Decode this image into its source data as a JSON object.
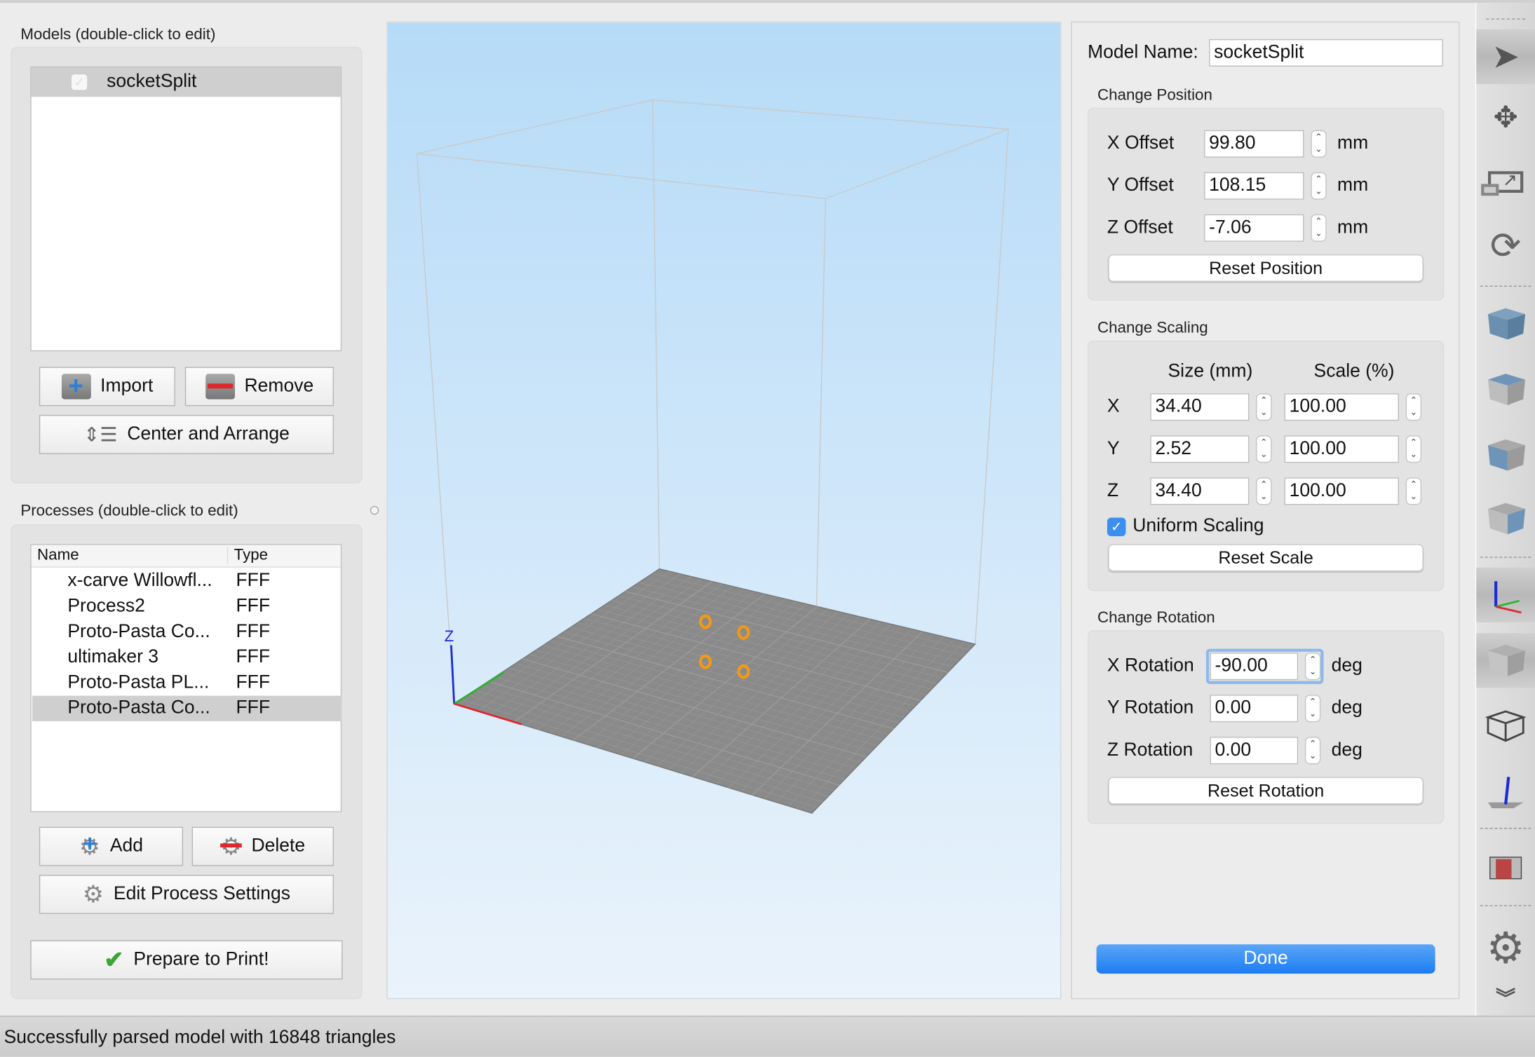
{
  "models": {
    "label": "Models (double-click to edit)",
    "items": [
      {
        "name": "socketSplit",
        "checked": true,
        "selected": true
      }
    ],
    "import_label": "Import",
    "remove_label": "Remove",
    "center_label": "Center and Arrange"
  },
  "processes": {
    "label": "Processes (double-click to edit)",
    "columns": [
      "Name",
      "Type"
    ],
    "rows": [
      {
        "name": "x-carve Willowfl...",
        "type": "FFF"
      },
      {
        "name": "Process2",
        "type": "FFF"
      },
      {
        "name": "Proto-Pasta Co...",
        "type": "FFF"
      },
      {
        "name": "ultimaker 3",
        "type": "FFF"
      },
      {
        "name": "Proto-Pasta PL...",
        "type": "FFF"
      },
      {
        "name": "Proto-Pasta Co...",
        "type": "FFF",
        "selected": true
      }
    ],
    "add_label": "Add",
    "delete_label": "Delete",
    "edit_label": "Edit Process Settings",
    "prepare_label": "Prepare to Print!"
  },
  "viewport": {
    "axis_z_label": "Z",
    "bg_top": "#b6dbf8",
    "bg_bottom": "#eaf3fb",
    "plate_color": "#8a8a8a",
    "model_color": "#f39a12"
  },
  "editor": {
    "model_name_label": "Model Name:",
    "model_name": "socketSplit",
    "position": {
      "title": "Change Position",
      "rows": [
        {
          "label": "X Offset",
          "value": "99.80",
          "unit": "mm"
        },
        {
          "label": "Y Offset",
          "value": "108.15",
          "unit": "mm"
        },
        {
          "label": "Z Offset",
          "value": "-7.06",
          "unit": "mm"
        }
      ],
      "reset_label": "Reset Position"
    },
    "scaling": {
      "title": "Change Scaling",
      "size_header": "Size (mm)",
      "scale_header": "Scale (%)",
      "rows": [
        {
          "axis": "X",
          "size": "34.40",
          "scale": "100.00"
        },
        {
          "axis": "Y",
          "size": "2.52",
          "scale": "100.00"
        },
        {
          "axis": "Z",
          "size": "34.40",
          "scale": "100.00"
        }
      ],
      "uniform_label": "Uniform Scaling",
      "uniform_checked": true,
      "reset_label": "Reset Scale"
    },
    "rotation": {
      "title": "Change Rotation",
      "rows": [
        {
          "label": "X Rotation",
          "value": "-90.00",
          "unit": "deg"
        },
        {
          "label": "Y Rotation",
          "value": "0.00",
          "unit": "deg"
        },
        {
          "label": "Z Rotation",
          "value": "0.00",
          "unit": "deg"
        }
      ],
      "reset_label": "Reset Rotation"
    },
    "done_label": "Done",
    "accent": "#2f8cf4"
  },
  "toolbar": {
    "items": [
      "select-icon",
      "move-icon",
      "scale-icon",
      "rotate-icon",
      "view-top-icon",
      "view-front-icon",
      "view-left-icon",
      "view-right-icon",
      "axes-icon",
      "solid-view-icon",
      "wireframe-view-icon",
      "normals-icon",
      "cutaway-icon",
      "settings-gear-icon",
      "more-chevron-icon"
    ]
  },
  "status": {
    "message": "Successfully parsed model with 16848 triangles"
  }
}
